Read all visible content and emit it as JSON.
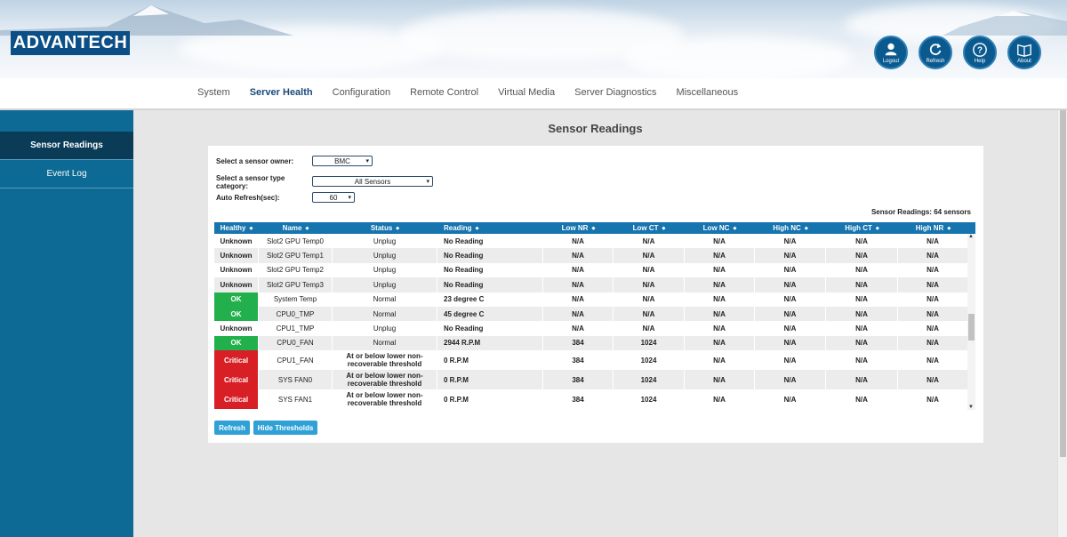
{
  "brand": "ADVANTECH",
  "header_buttons": [
    {
      "label": "Logout",
      "icon": "user-icon"
    },
    {
      "label": "Refresh",
      "icon": "refresh-icon"
    },
    {
      "label": "Help",
      "icon": "help-icon"
    },
    {
      "label": "About",
      "icon": "book-icon"
    }
  ],
  "nav": [
    "System",
    "Server Health",
    "Configuration",
    "Remote Control",
    "Virtual Media",
    "Server Diagnostics",
    "Miscellaneous"
  ],
  "nav_active": "Server Health",
  "sidebar": [
    "Sensor Readings",
    "Event Log"
  ],
  "sidebar_active": "Sensor Readings",
  "page_title": "Sensor Readings",
  "form": {
    "owner_label": "Select a sensor owner:",
    "owner_value": "BMC",
    "type_label": "Select a sensor type category:",
    "type_value": "All Sensors",
    "refresh_label": "Auto Refresh(sec):",
    "refresh_value": "60"
  },
  "sensor_count": "Sensor Readings: 64 sensors",
  "columns": [
    "Healthy",
    "Name",
    "Status",
    "Reading",
    "Low NR",
    "Low CT",
    "Low NC",
    "High NC",
    "High CT",
    "High NR"
  ],
  "rows": [
    {
      "healthy": "Unknown",
      "name": "Slot2 GPU Temp0",
      "status": "Unplug",
      "reading": "No Reading",
      "low_nr": "N/A",
      "low_ct": "N/A",
      "low_nc": "N/A",
      "high_nc": "N/A",
      "high_ct": "N/A",
      "high_nr": "N/A"
    },
    {
      "healthy": "Unknown",
      "name": "Slot2 GPU Temp1",
      "status": "Unplug",
      "reading": "No Reading",
      "low_nr": "N/A",
      "low_ct": "N/A",
      "low_nc": "N/A",
      "high_nc": "N/A",
      "high_ct": "N/A",
      "high_nr": "N/A"
    },
    {
      "healthy": "Unknown",
      "name": "Slot2 GPU Temp2",
      "status": "Unplug",
      "reading": "No Reading",
      "low_nr": "N/A",
      "low_ct": "N/A",
      "low_nc": "N/A",
      "high_nc": "N/A",
      "high_ct": "N/A",
      "high_nr": "N/A"
    },
    {
      "healthy": "Unknown",
      "name": "Slot2 GPU Temp3",
      "status": "Unplug",
      "reading": "No Reading",
      "low_nr": "N/A",
      "low_ct": "N/A",
      "low_nc": "N/A",
      "high_nc": "N/A",
      "high_ct": "N/A",
      "high_nr": "N/A"
    },
    {
      "healthy": "OK",
      "name": "System Temp",
      "status": "Normal",
      "reading": "23 degree C",
      "low_nr": "N/A",
      "low_ct": "N/A",
      "low_nc": "N/A",
      "high_nc": "N/A",
      "high_ct": "N/A",
      "high_nr": "N/A"
    },
    {
      "healthy": "OK",
      "name": "CPU0_TMP",
      "status": "Normal",
      "reading": "45 degree C",
      "low_nr": "N/A",
      "low_ct": "N/A",
      "low_nc": "N/A",
      "high_nc": "N/A",
      "high_ct": "N/A",
      "high_nr": "N/A"
    },
    {
      "healthy": "Unknown",
      "name": "CPU1_TMP",
      "status": "Unplug",
      "reading": "No Reading",
      "low_nr": "N/A",
      "low_ct": "N/A",
      "low_nc": "N/A",
      "high_nc": "N/A",
      "high_ct": "N/A",
      "high_nr": "N/A"
    },
    {
      "healthy": "OK",
      "name": "CPU0_FAN",
      "status": "Normal",
      "reading": "2944 R.P.M",
      "low_nr": "384",
      "low_ct": "1024",
      "low_nc": "N/A",
      "high_nc": "N/A",
      "high_ct": "N/A",
      "high_nr": "N/A"
    },
    {
      "healthy": "Critical",
      "name": "CPU1_FAN",
      "status": "At or below lower non-recoverable threshold",
      "reading": "0 R.P.M",
      "low_nr": "384",
      "low_ct": "1024",
      "low_nc": "N/A",
      "high_nc": "N/A",
      "high_ct": "N/A",
      "high_nr": "N/A"
    },
    {
      "healthy": "Critical",
      "name": "SYS FAN0",
      "status": "At or below lower non-recoverable threshold",
      "reading": "0 R.P.M",
      "low_nr": "384",
      "low_ct": "1024",
      "low_nc": "N/A",
      "high_nc": "N/A",
      "high_ct": "N/A",
      "high_nr": "N/A"
    },
    {
      "healthy": "Critical",
      "name": "SYS FAN1",
      "status": "At or below lower non-recoverable threshold",
      "reading": "0 R.P.M",
      "low_nr": "384",
      "low_ct": "1024",
      "low_nc": "N/A",
      "high_nc": "N/A",
      "high_ct": "N/A",
      "high_nr": "N/A"
    }
  ],
  "buttons": {
    "refresh": "Refresh",
    "hide_thresholds": "Hide Thresholds"
  },
  "colors": {
    "ok": "#21b04b",
    "critical": "#d81f26",
    "header": "#1674ae",
    "sidebar": "#0d6a94"
  }
}
